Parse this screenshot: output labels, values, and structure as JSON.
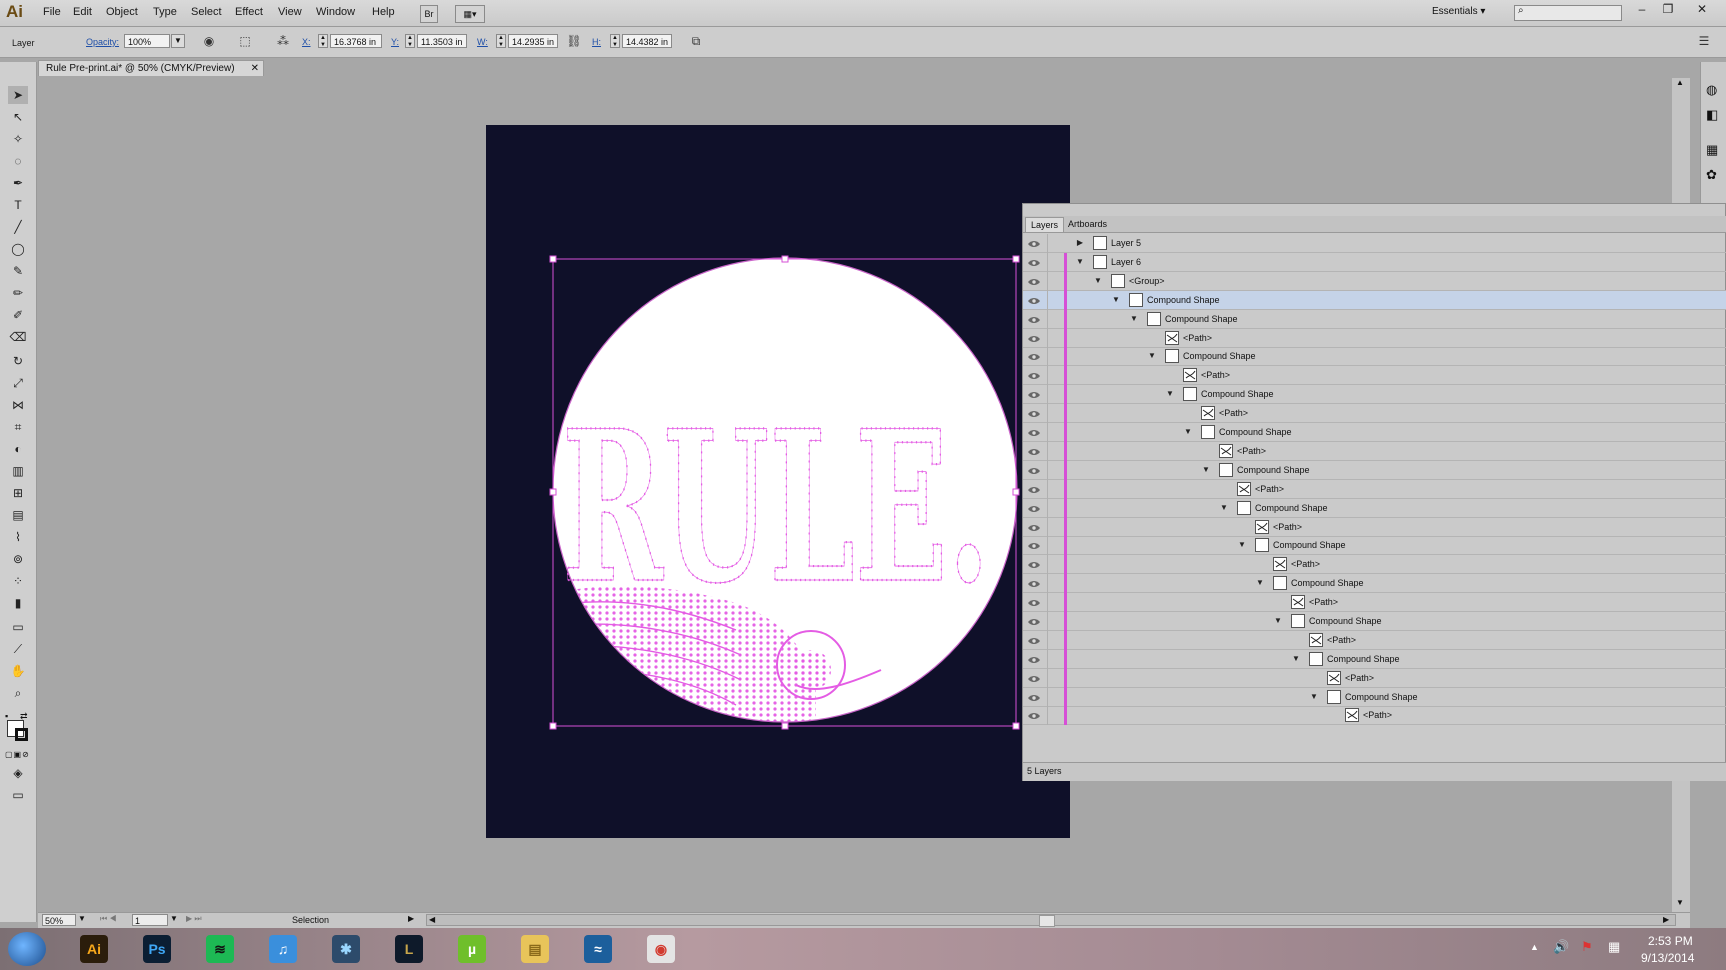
{
  "menubar": {
    "app_logo": "Ai",
    "items": [
      "File",
      "Edit",
      "Object",
      "Type",
      "Select",
      "Effect",
      "View",
      "Window",
      "Help"
    ],
    "bridge_label": "Br",
    "workspace_label": "Essentials",
    "search_placeholder": ""
  },
  "controlbar": {
    "selection_label": "Layer",
    "opacity_label": "Opacity:",
    "opacity_value": "100%",
    "x_label": "X:",
    "x_value": "16.3768 in",
    "y_label": "Y:",
    "y_value": "11.3503 in",
    "w_label": "W:",
    "w_value": "14.2935 in",
    "h_label": "H:",
    "h_value": "14.4382 in"
  },
  "document": {
    "tab_title": "Rule Pre-print.ai* @ 50% (CMYK/Preview)",
    "artwork_text": "RULE."
  },
  "layers_panel": {
    "tabs": [
      "Layers",
      "Artboards"
    ],
    "active_tab": "Layers",
    "footer_count": "5 Layers",
    "rows": [
      {
        "name": "Layer 5",
        "indent": 0,
        "expanded": false,
        "selected": false
      },
      {
        "name": "Layer 6",
        "indent": 0,
        "expanded": true,
        "selected": false
      },
      {
        "name": "<Group>",
        "indent": 1,
        "expanded": true,
        "selected": false
      },
      {
        "name": "Compound Shape",
        "indent": 2,
        "expanded": true,
        "selected": true
      },
      {
        "name": "Compound Shape",
        "indent": 3,
        "expanded": true,
        "selected": false
      },
      {
        "name": "<Path>",
        "indent": 4,
        "expanded": null,
        "selected": false
      },
      {
        "name": "Compound Shape",
        "indent": 4,
        "expanded": true,
        "selected": false
      },
      {
        "name": "<Path>",
        "indent": 5,
        "expanded": null,
        "selected": false
      },
      {
        "name": "Compound Shape",
        "indent": 5,
        "expanded": true,
        "selected": false
      },
      {
        "name": "<Path>",
        "indent": 6,
        "expanded": null,
        "selected": false
      },
      {
        "name": "Compound Shape",
        "indent": 6,
        "expanded": true,
        "selected": false
      },
      {
        "name": "<Path>",
        "indent": 7,
        "expanded": null,
        "selected": false
      },
      {
        "name": "Compound Shape",
        "indent": 7,
        "expanded": true,
        "selected": false
      },
      {
        "name": "<Path>",
        "indent": 8,
        "expanded": null,
        "selected": false
      },
      {
        "name": "Compound Shape",
        "indent": 8,
        "expanded": true,
        "selected": false
      },
      {
        "name": "<Path>",
        "indent": 9,
        "expanded": null,
        "selected": false
      },
      {
        "name": "Compound Shape",
        "indent": 9,
        "expanded": true,
        "selected": false
      },
      {
        "name": "<Path>",
        "indent": 10,
        "expanded": null,
        "selected": false
      },
      {
        "name": "Compound Shape",
        "indent": 10,
        "expanded": true,
        "selected": false
      },
      {
        "name": "<Path>",
        "indent": 11,
        "expanded": null,
        "selected": false
      },
      {
        "name": "Compound Shape",
        "indent": 11,
        "expanded": true,
        "selected": false
      },
      {
        "name": "<Path>",
        "indent": 12,
        "expanded": null,
        "selected": false
      },
      {
        "name": "Compound Shape",
        "indent": 12,
        "expanded": true,
        "selected": false
      },
      {
        "name": "<Path>",
        "indent": 13,
        "expanded": null,
        "selected": false
      },
      {
        "name": "Compound Shape",
        "indent": 13,
        "expanded": true,
        "selected": false
      },
      {
        "name": "<Path>",
        "indent": 14,
        "expanded": null,
        "selected": false
      }
    ]
  },
  "statusbar": {
    "zoom": "50%",
    "artboard_number": "1",
    "tool_name": "Selection"
  },
  "taskbar": {
    "apps": [
      {
        "name": "illustrator",
        "label": "Ai",
        "color": "#2b1d0b",
        "fg": "#f7a81b"
      },
      {
        "name": "photoshop",
        "label": "Ps",
        "color": "#0b1e33",
        "fg": "#3fa7f5"
      },
      {
        "name": "spotify",
        "label": "≋",
        "color": "#1db954",
        "fg": "#111111"
      },
      {
        "name": "itunes",
        "label": "♫",
        "color": "#3a8fdc",
        "fg": "#ffffff"
      },
      {
        "name": "app-blue-circle",
        "label": "✱",
        "color": "#2d4b6b",
        "fg": "#9ad7ff"
      },
      {
        "name": "league",
        "label": "L",
        "color": "#0e1a2a",
        "fg": "#c8a64b"
      },
      {
        "name": "utorrent",
        "label": "µ",
        "color": "#6fbf2b",
        "fg": "#ffffff"
      },
      {
        "name": "file-explorer",
        "label": "▤",
        "color": "#e8c45a",
        "fg": "#8a6a1a"
      },
      {
        "name": "app-swirl",
        "label": "≈",
        "color": "#1c5f9c",
        "fg": "#ffffff"
      },
      {
        "name": "chrome",
        "label": "◉",
        "color": "#e4e4e4",
        "fg": "#d23a2f"
      }
    ],
    "time": "2:53 PM",
    "date": "9/13/2014"
  },
  "colors": {
    "artboard_bg": "#0f1029",
    "selection_magenta": "#e45ce4",
    "selected_row": "#c5d3e8"
  }
}
